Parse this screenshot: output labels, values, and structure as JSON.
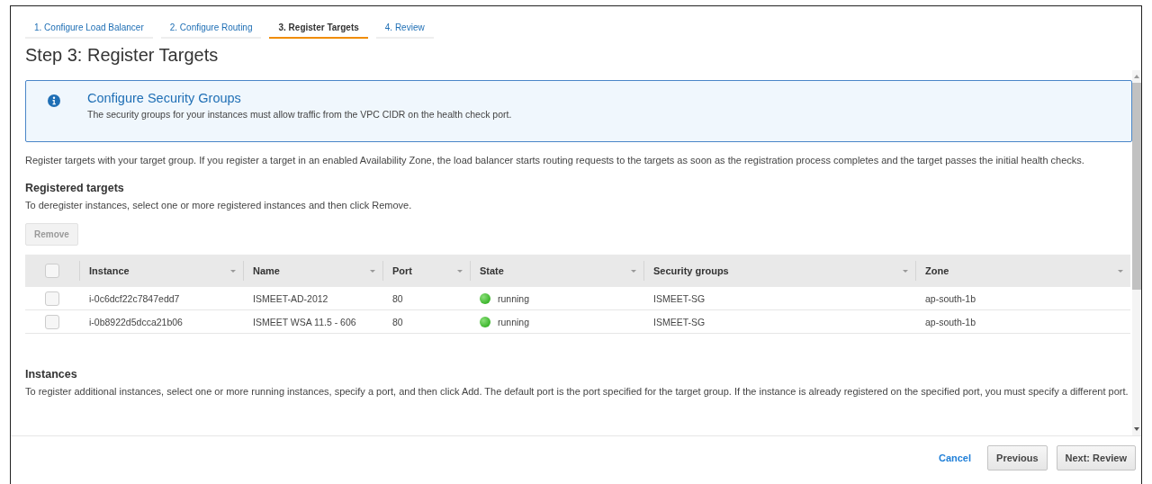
{
  "tabs": [
    {
      "label": "1. Configure Load Balancer",
      "selected": false
    },
    {
      "label": "2. Configure Routing",
      "selected": false
    },
    {
      "label": "3. Register Targets",
      "selected": true
    },
    {
      "label": "4. Review",
      "selected": false
    }
  ],
  "title": "Step 3: Register Targets",
  "alert": {
    "title": "Configure Security Groups",
    "message": "The security groups for your instances must allow traffic from the VPC CIDR on the health check port."
  },
  "intro": "Register targets with your target group. If you register a target in an enabled Availability Zone, the load balancer starts routing requests to the targets as soon as the registration process completes and the target passes the initial health checks.",
  "registered": {
    "heading": "Registered targets",
    "description": "To deregister instances, select one or more registered instances and then click Remove.",
    "remove_button": {
      "label": "Remove",
      "disabled": true
    },
    "table": {
      "select_all": {
        "checked": false
      },
      "columns": [
        "Instance",
        "Name",
        "Port",
        "State",
        "Security groups",
        "Zone"
      ],
      "rows": [
        {
          "checked": false,
          "cells": [
            "i-0c6dcf22c7847edd7",
            "ISMEET-AD-2012",
            "80",
            "running",
            "ISMEET-SG",
            "ap-south-1b"
          ]
        },
        {
          "checked": false,
          "cells": [
            "i-0b8922d5dcca21b06",
            "ISMEET WSA 11.5 - 606",
            "80",
            "running",
            "ISMEET-SG",
            "ap-south-1b"
          ]
        }
      ]
    }
  },
  "instances": {
    "heading": "Instances",
    "description": "To register additional instances, select one or more running instances, specify a port, and then click Add. The default port is the port specified for the target group. If the instance is already registered on the specified port, you must specify a different port."
  },
  "footer": {
    "cancel": "Cancel",
    "previous": "Previous",
    "next": "Next: Review"
  }
}
